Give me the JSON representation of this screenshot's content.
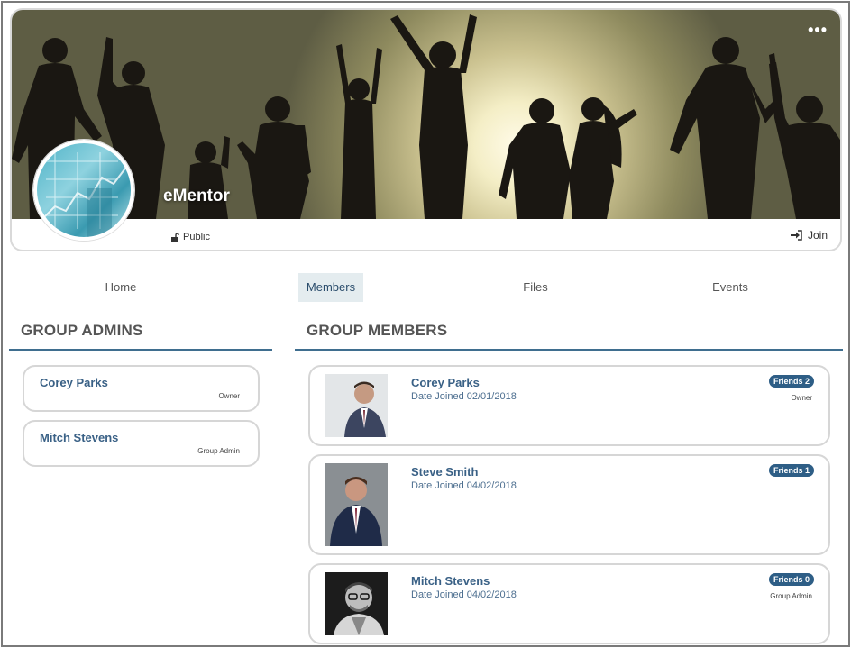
{
  "group": {
    "name": "eMentor",
    "privacy": "Public",
    "join_label": "Join",
    "more_label": "•••"
  },
  "tabs": [
    {
      "label": "Home"
    },
    {
      "label": "Members",
      "active": true
    },
    {
      "label": "Files"
    },
    {
      "label": "Events"
    }
  ],
  "admins_section": {
    "title": "GROUP ADMINS",
    "items": [
      {
        "name": "Corey Parks",
        "role": "Owner"
      },
      {
        "name": "Mitch Stevens",
        "role": "Group Admin"
      }
    ]
  },
  "members_section": {
    "title": "GROUP MEMBERS",
    "items": [
      {
        "name": "Corey Parks",
        "joined": "Date Joined 02/01/2018",
        "friends": "Friends 2",
        "role": "Owner"
      },
      {
        "name": "Steve Smith",
        "joined": "Date Joined 04/02/2018",
        "friends": "Friends 1",
        "role": ""
      },
      {
        "name": "Mitch Stevens",
        "joined": "Date Joined 04/02/2018",
        "friends": "Friends 0",
        "role": "Group Admin"
      }
    ]
  },
  "colors": {
    "accent": "#2e5e86",
    "link": "#3a6186",
    "rule": "#3f6e8f",
    "active_tab_bg": "#e4ecef"
  }
}
